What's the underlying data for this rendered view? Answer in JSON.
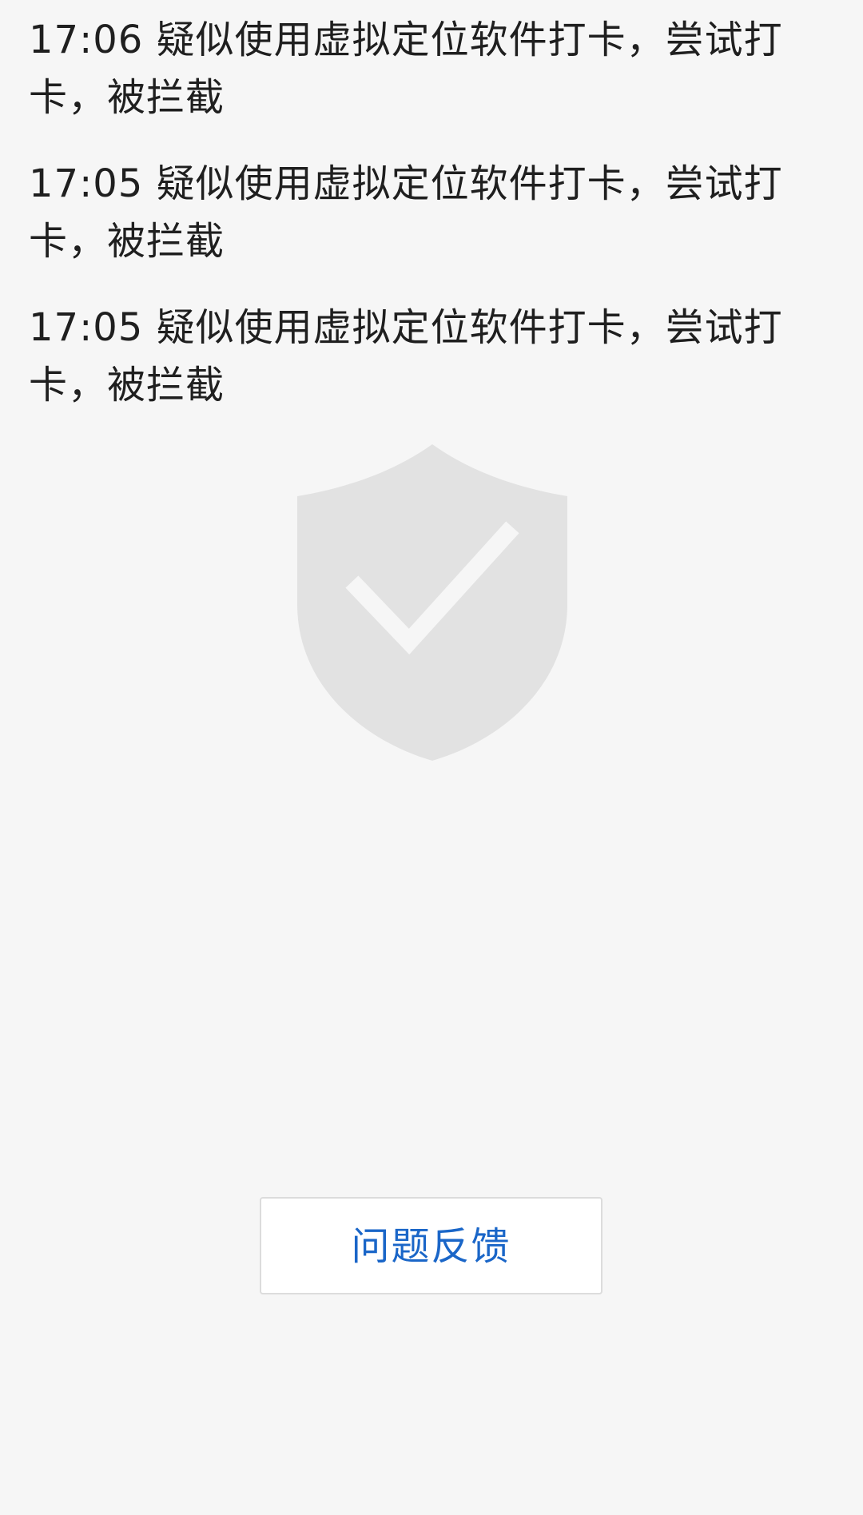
{
  "log": {
    "items": [
      {
        "text": "17:06 疑似使用虚拟定位软件打卡，尝试打卡，被拦截"
      },
      {
        "text": "17:05 疑似使用虚拟定位软件打卡，尝试打卡，被拦截"
      },
      {
        "text": "17:05 疑似使用虚拟定位软件打卡，尝试打卡，被拦截"
      }
    ]
  },
  "status": {
    "icon": "shield-check-icon",
    "icon_color": "#e2e2e2"
  },
  "feedback": {
    "label": "问题反馈",
    "color": "#1a66c8"
  },
  "colors": {
    "background": "#f6f6f6",
    "text": "#1f1f1f"
  }
}
